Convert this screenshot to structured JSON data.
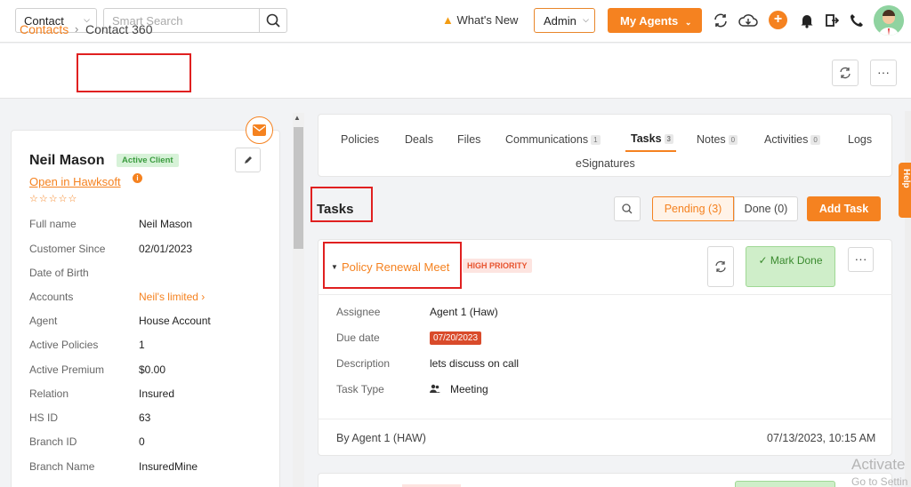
{
  "topbar": {
    "module_select": "Contact",
    "search_placeholder": "Smart Search",
    "whats_new": "What's New",
    "admin_select": "Admin",
    "my_agents": "My Agents"
  },
  "breadcrumb": {
    "root": "Contacts",
    "separator": "›",
    "current": "Contact 360"
  },
  "contact": {
    "name": "Neil Mason",
    "status_badge": "Active Client",
    "hawksoft_link": "Open in Hawksoft",
    "rating_stars": "☆☆☆☆☆",
    "fields": [
      {
        "label": "Full name",
        "value": "Neil Mason"
      },
      {
        "label": "Customer Since",
        "value": "02/01/2023"
      },
      {
        "label": "Date of Birth",
        "value": ""
      },
      {
        "label": "Accounts",
        "value": "Neil's limited ›"
      },
      {
        "label": "Agent",
        "value": "House Account"
      },
      {
        "label": "Active Policies",
        "value": "1"
      },
      {
        "label": "Active Premium",
        "value": "$0.00"
      },
      {
        "label": "Relation",
        "value": "Insured"
      },
      {
        "label": "HS ID",
        "value": "63"
      },
      {
        "label": "Branch ID",
        "value": "0"
      },
      {
        "label": "Branch Name",
        "value": "InsuredMine"
      }
    ]
  },
  "tabs": [
    {
      "label": "Policies",
      "count": ""
    },
    {
      "label": "Deals",
      "count": ""
    },
    {
      "label": "Files",
      "count": ""
    },
    {
      "label": "Communications",
      "count": "1"
    },
    {
      "label": "Tasks",
      "count": "3"
    },
    {
      "label": "Notes",
      "count": "0"
    },
    {
      "label": "Activities",
      "count": "0"
    },
    {
      "label": "Logs",
      "count": ""
    },
    {
      "label": "eSignatures",
      "count": ""
    }
  ],
  "active_tab": "Tasks",
  "tasks_section": {
    "title": "Tasks",
    "pending_label": "Pending (3)",
    "done_label": "Done (0)",
    "add_task_label": "Add Task"
  },
  "task": {
    "title": "Policy Renewal Meet",
    "priority": "HIGH PRIORITY",
    "mark_done": "✓  Mark Done",
    "assignee_label": "Assignee",
    "assignee": "Agent 1 (Haw)",
    "due_label": "Due date",
    "due": "07/20/2023",
    "description_label": "Description",
    "description": "lets discuss on call",
    "type_label": "Task Type",
    "type": "Meeting",
    "created_by": "By Agent 1 (HAW)",
    "created_at": "07/13/2023, 10:15 AM"
  },
  "help_tab": "Help",
  "watermark": {
    "line1": "Activate",
    "line2": "Go to Settin"
  },
  "colors": {
    "accent": "#f58220",
    "annotation_box": "#e02020",
    "due_badge": "#d94b2b",
    "mark_done_bg": "#cfeec9"
  }
}
